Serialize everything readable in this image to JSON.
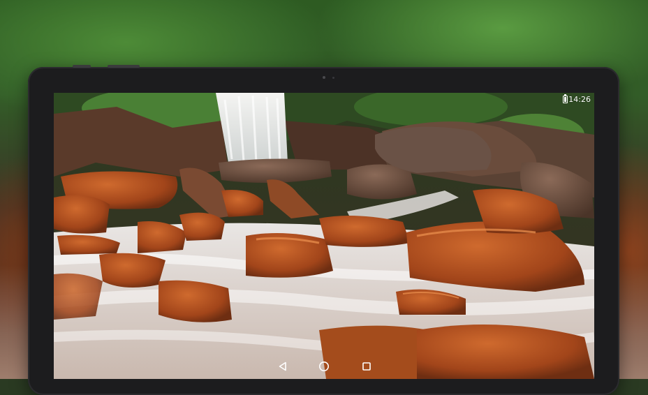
{
  "status_bar": {
    "time": "14:26",
    "battery_icon": "battery-full-icon"
  },
  "nav_bar": {
    "back_icon": "back-triangle-icon",
    "home_icon": "home-circle-icon",
    "recents_icon": "recents-square-icon"
  },
  "wallpaper": {
    "subject_icon": "waterfall-photo"
  },
  "colors": {
    "bezel": "#1c1c1e",
    "status_text": "#ffffff",
    "nav_icon": "#ffffff",
    "rock": "#b4521f",
    "water": "#e8e4e0",
    "foliage": "#3f7a2e"
  }
}
